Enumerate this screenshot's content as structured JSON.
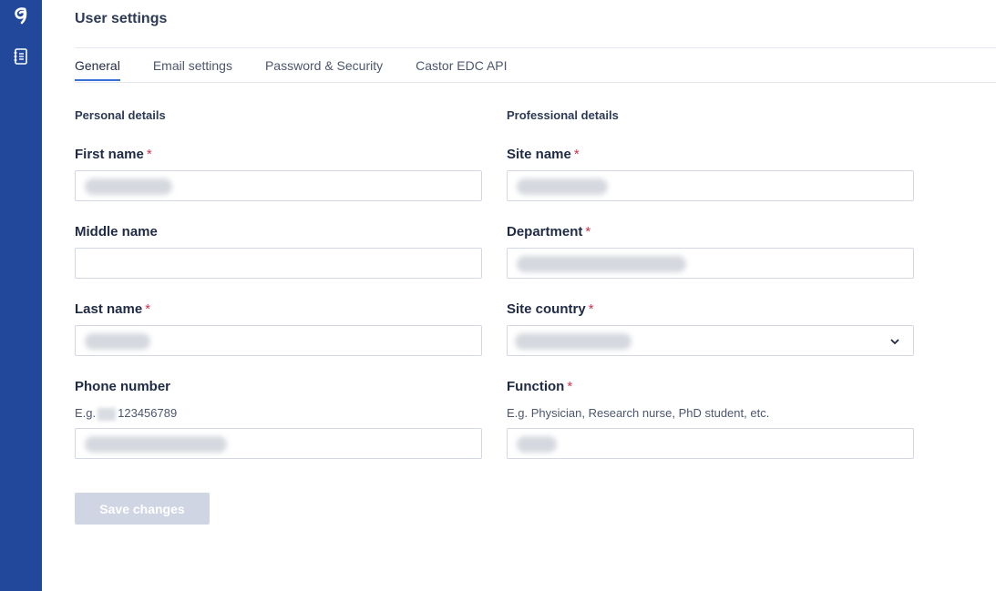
{
  "app": {
    "logo_icon": "castor-logo-icon",
    "sidebar_icons": [
      "castor-logo-icon",
      "address-book-icon"
    ]
  },
  "page": {
    "title": "User settings"
  },
  "tabs": [
    {
      "label": "General",
      "active": true
    },
    {
      "label": "Email settings",
      "active": false
    },
    {
      "label": "Password & Security",
      "active": false
    },
    {
      "label": "Castor EDC API",
      "active": false
    }
  ],
  "personal": {
    "title": "Personal details",
    "first_name": {
      "label": "First name",
      "required": "*"
    },
    "middle_name": {
      "label": "Middle name"
    },
    "last_name": {
      "label": "Last name",
      "required": "*"
    },
    "phone": {
      "label": "Phone number",
      "hint_prefix": "E.g.",
      "hint_suffix": "123456789"
    }
  },
  "professional": {
    "title": "Professional details",
    "site_name": {
      "label": "Site name",
      "required": "*"
    },
    "department": {
      "label": "Department",
      "required": "*"
    },
    "site_country": {
      "label": "Site country",
      "required": "*",
      "icon": "chevron-down-icon"
    },
    "function": {
      "label": "Function",
      "required": "*",
      "hint": "E.g. Physician, Research nurse, PhD student, etc."
    }
  },
  "actions": {
    "save_label": "Save changes"
  },
  "colors": {
    "sidebar": "#21489a",
    "accent": "#3a6fd8",
    "required": "#d0314b",
    "disabled_button": "#cfd5e3"
  }
}
